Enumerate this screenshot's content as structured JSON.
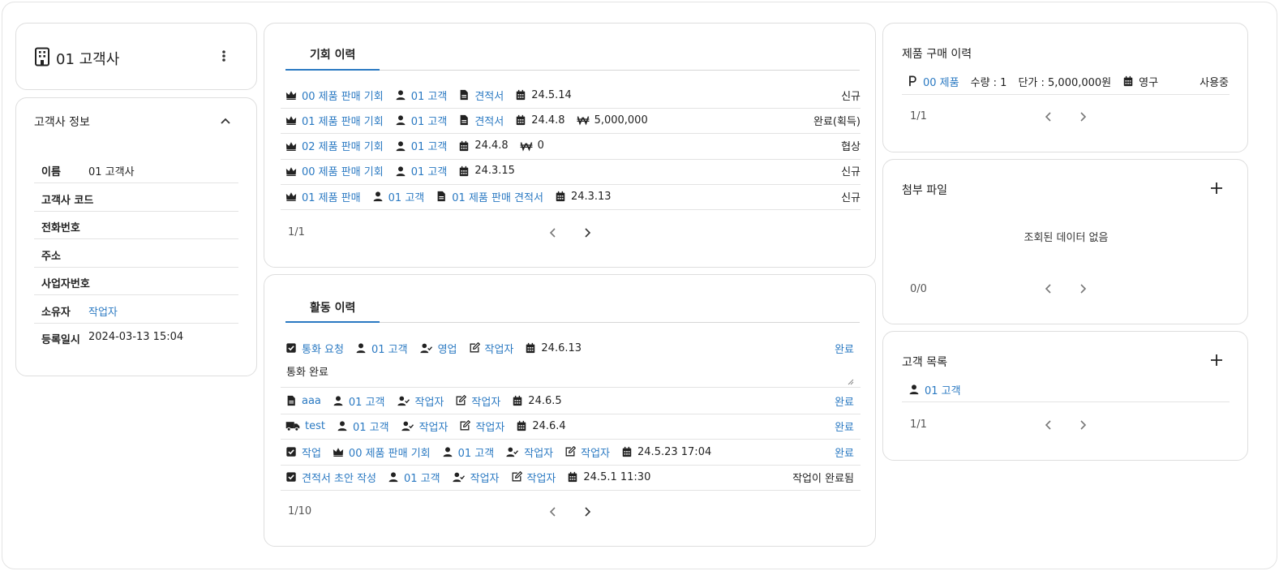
{
  "company": {
    "title": "01 고객사"
  },
  "info": {
    "title": "고객사 정보",
    "fields": [
      {
        "label": "이름",
        "value": "01 고객사"
      },
      {
        "label": "고객사 코드",
        "value": ""
      },
      {
        "label": "전화번호",
        "value": ""
      },
      {
        "label": "주소",
        "value": ""
      },
      {
        "label": "사업자번호",
        "value": ""
      },
      {
        "label": "소유자",
        "value": "작업자"
      },
      {
        "label": "등록일시",
        "value": "2024-03-13 15:04"
      }
    ]
  },
  "opportunities": {
    "tab": "기회 이력",
    "rows": [
      {
        "name": "00 제품 판매 기회",
        "customer": "01 고객",
        "doc": "견적서",
        "date": "24.5.14",
        "amount": "",
        "status": "신규"
      },
      {
        "name": "01 제품 판매 기회",
        "customer": "01 고객",
        "doc": "견적서",
        "date": "24.4.8",
        "amount": "5,000,000",
        "status": "완료(획득)"
      },
      {
        "name": "02 제품 판매 기회",
        "customer": "01 고객",
        "doc": "",
        "date": "24.4.8",
        "amount": "0",
        "status": "협상"
      },
      {
        "name": "00 제품 판매 기회",
        "customer": "01 고객",
        "doc": "",
        "date": "24.3.15",
        "amount": "",
        "status": "신규"
      },
      {
        "name": "01 제품 판매",
        "customer": "01 고객",
        "doc": "01 제품 판매 견적서",
        "date": "24.3.13",
        "amount": "",
        "status": "신규"
      }
    ],
    "pager": "1/1"
  },
  "activities": {
    "tab": "활동 이력",
    "rows": [
      {
        "type": "통화 요청",
        "icon": "check-square-icon",
        "opportunity": "",
        "customer": "01 고객",
        "assignee": "영업",
        "author": "작업자",
        "date": "24.6.13",
        "status": "완료",
        "note": "통화 완료"
      },
      {
        "type": "aaa",
        "icon": "document-icon",
        "opportunity": "",
        "customer": "01 고객",
        "assignee": "작업자",
        "author": "작업자",
        "date": "24.6.5",
        "status": "완료"
      },
      {
        "type": "test",
        "icon": "truck-icon",
        "opportunity": "",
        "customer": "01 고객",
        "assignee": "작업자",
        "author": "작업자",
        "date": "24.6.4",
        "status": "완료"
      },
      {
        "type": "작업",
        "icon": "check-square-icon",
        "opportunity": "00 제품 판매 기회",
        "customer": "01 고객",
        "assignee": "작업자",
        "author": "작업자",
        "date": "24.5.23 17:04",
        "status": "완료"
      },
      {
        "type": "견적서 초안 작성",
        "icon": "check-square-icon",
        "opportunity": "",
        "customer": "01 고객",
        "assignee": "작업자",
        "author": "작업자",
        "date": "24.5.1 11:30",
        "status": "작업이 완료됨"
      }
    ],
    "pager": "1/10"
  },
  "purchases": {
    "title": "제품 구매 이력",
    "rows": [
      {
        "product": "00 제품",
        "qty": "수량 : 1",
        "price": "단가 : 5,000,000원",
        "term": "영구",
        "status": "사용중"
      }
    ],
    "pager": "1/1"
  },
  "attachments": {
    "title": "첨부 파일",
    "empty": "조회된 데이터 없음",
    "pager": "0/0"
  },
  "customers": {
    "title": "고객 목록",
    "rows": [
      {
        "name": "01 고객"
      }
    ],
    "pager": "1/1"
  },
  "colors": {
    "accent": "#2a79c2",
    "border": "#dedede"
  }
}
